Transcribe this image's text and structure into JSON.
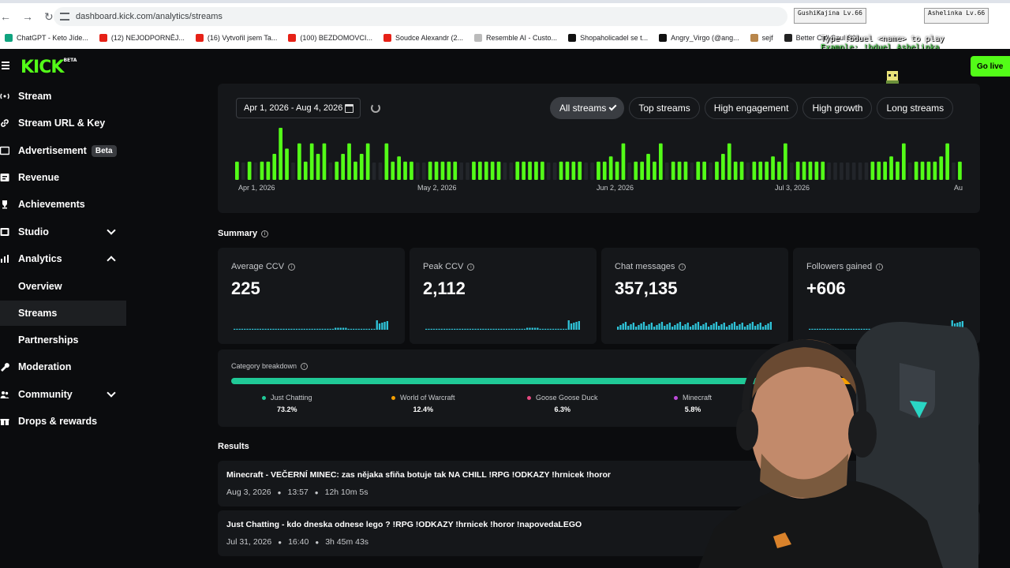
{
  "browser": {
    "url": "dashboard.kick.com/analytics/streams",
    "bookmarks": [
      {
        "label": "ChatGPT - Keto Jíde...",
        "color": "#10a37f"
      },
      {
        "label": "(12) NEJODPORNĚJ...",
        "color": "#e62117"
      },
      {
        "label": "(16) Vytvořil jsem Ta...",
        "color": "#e62117"
      },
      {
        "label": "(100) BEZDOMOVCI...",
        "color": "#e62117"
      },
      {
        "label": "Soudce Alexandr (2...",
        "color": "#e62117"
      },
      {
        "label": "Resemble AI - Custo...",
        "color": "#bbbbbb"
      },
      {
        "label": "Shopaholicadel se t...",
        "color": "#111111"
      },
      {
        "label": "Angry_Virgo (@ang...",
        "color": "#111111"
      },
      {
        "label": "sejf",
        "color": "#b8864b"
      },
      {
        "label": "Better Call Saul S01...",
        "color": "#222222"
      }
    ],
    "hud_left": "GushiKajina Lv.66",
    "hud_right": "Ashelinka Lv.66",
    "overlay_line1": "Type !bduel <name> to play",
    "overlay_line2": "Example: !bduel Ashelinka"
  },
  "header": {
    "logo": "KICK",
    "logo_badge": "BETA",
    "go_live": "Go live"
  },
  "sidebar": {
    "items": [
      {
        "label": "Stream"
      },
      {
        "label": "Stream URL & Key"
      },
      {
        "label": "Advertisement",
        "badge": "Beta"
      },
      {
        "label": "Revenue"
      },
      {
        "label": "Achievements"
      },
      {
        "label": "Studio"
      },
      {
        "label": "Analytics"
      },
      {
        "label": "Overview"
      },
      {
        "label": "Streams"
      },
      {
        "label": "Partnerships"
      },
      {
        "label": "Moderation"
      },
      {
        "label": "Community"
      },
      {
        "label": "Drops & rewards"
      }
    ]
  },
  "filters": {
    "date_range": "Apr 1, 2026 - Aug 4, 2026",
    "chips": [
      "All streams",
      "Top streams",
      "High engagement",
      "High growth",
      "Long streams"
    ],
    "active": "All streams"
  },
  "timeline": {
    "labels": [
      "Apr 1, 2026",
      "May 2, 2026",
      "Jun 2, 2026",
      "Jul 3, 2026",
      "Au"
    ],
    "accent": "#53fc18",
    "bars": [
      0.35,
      0,
      0.35,
      0,
      0.35,
      0.35,
      0.5,
      1,
      0.6,
      0,
      0.7,
      0.35,
      0.7,
      0.5,
      0.7,
      0,
      0.35,
      0.5,
      0.7,
      0.35,
      0.5,
      0.7,
      0,
      0,
      0.7,
      0.35,
      0.45,
      0.35,
      0.35,
      0,
      0,
      0.35,
      0.35,
      0.35,
      0.35,
      0.35,
      0,
      0,
      0.35,
      0.35,
      0.35,
      0.35,
      0.35,
      0,
      0,
      0.35,
      0.35,
      0.35,
      0.35,
      0.35,
      0,
      0,
      0.35,
      0.35,
      0.35,
      0.35,
      0,
      0,
      0.35,
      0.35,
      0.45,
      0.35,
      0.7,
      0,
      0.35,
      0.35,
      0.5,
      0.35,
      0.7,
      0,
      0.35,
      0.35,
      0.35,
      0,
      0.35,
      0.35,
      0,
      0.35,
      0.5,
      0.7,
      0.35,
      0.35,
      0,
      0.35,
      0.35,
      0.35,
      0.45,
      0.35,
      0.7,
      0,
      0.35,
      0.35,
      0.35,
      0.35,
      0.35,
      0,
      0,
      0,
      0,
      0,
      0,
      0,
      0.35,
      0.35,
      0.35,
      0.45,
      0.35,
      0.7,
      0,
      0.35,
      0.35,
      0.35,
      0.35,
      0.45,
      0.7,
      0,
      0.35
    ]
  },
  "summary": {
    "title": "Summary",
    "cards": [
      {
        "label": "Average CCV",
        "value": "225"
      },
      {
        "label": "Peak CCV",
        "value": "2,112"
      },
      {
        "label": "Chat messages",
        "value": "357,135"
      },
      {
        "label": "Followers gained",
        "value": "+606"
      }
    ]
  },
  "category": {
    "title": "Category breakdown",
    "items": [
      {
        "name": "Just Chatting",
        "pct": "73.2%",
        "color": "#20c997"
      },
      {
        "name": "World of Warcraft",
        "pct": "12.4%",
        "color": "#f59f00"
      },
      {
        "name": "Goose Goose Duck",
        "pct": "6.3%",
        "color": "#e64980"
      },
      {
        "name": "Minecraft",
        "pct": "5.8%",
        "color": "#be4bdb"
      }
    ],
    "shares": [
      73.2,
      12.4,
      6.3,
      5.8
    ]
  },
  "results": {
    "title": "Results",
    "rows": [
      {
        "title": "Minecraft - VEČERNÍ MINEC: zas nějaka sfiňa botuje tak NA CHILL !RPG !ODKAZY !hrnicek !horor",
        "date": "Aug 3, 2026",
        "time": "13:57",
        "duration": "12h 10m 5s"
      },
      {
        "title": "Just Chatting - kdo dneska odnese lego ? !RPG !ODKAZY !hrnicek !horor !napovedaLEGO",
        "date": "Jul 31, 2026",
        "time": "16:40",
        "duration": "3h 45m 43s"
      }
    ]
  }
}
